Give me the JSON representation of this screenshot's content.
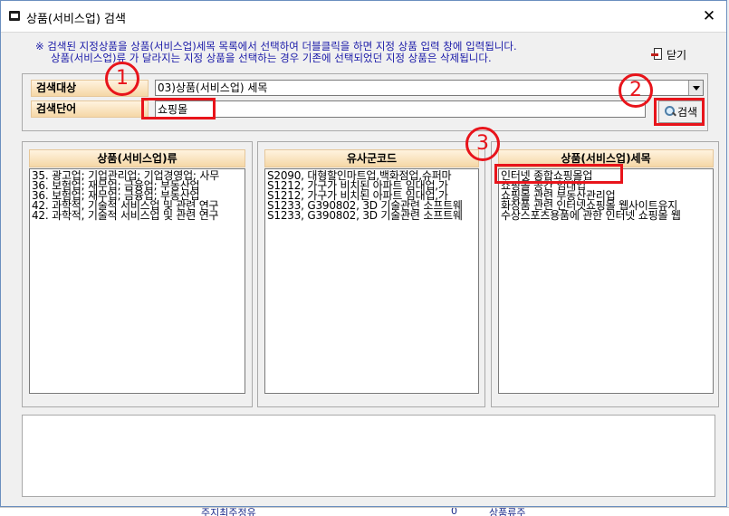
{
  "window": {
    "title": "상품(서비스업) 검색",
    "close_glyph": "✕"
  },
  "notice": {
    "line1": "※ 검색된 지정상품을 상품(서비스업)세목 목록에서 선택하여 더블클릭을 하면 지정 상품 입력 창에 입력됩니다.",
    "line2": "상품(서비스업)류 가 달라지는 지정 상품을 선택하는 경우 기존에 선택되었던 지정 상품은 삭제됩니다."
  },
  "toolbar": {
    "close_label": "닫기",
    "close_icon": "door-exit-icon"
  },
  "search": {
    "target_label": "검색대상",
    "target_value": "03)상품(서비스업) 세목",
    "keyword_label": "검색단어",
    "keyword_value": "쇼핑몰",
    "search_button_label": "검색",
    "search_icon": "magnifier-icon"
  },
  "panels": {
    "class": {
      "header": "상품(서비스업)류",
      "items": [
        "35. 광고업; 기업관리업; 기업경영업; 사무",
        "36. 보험업; 재무업; 금융업; 부동산업",
        "36. 보험업; 재무업; 금융업; 부동산업",
        "42. 과학적, 기술적 서비스업 및 관련 연구",
        "42. 과학적, 기술적 서비스업 및 관련 연구"
      ]
    },
    "similar": {
      "header": "유사군코드",
      "items": [
        "S2090, 대형할인마트업,백화점업,슈퍼마",
        "S1212, 가구가 비치된 아파트 임대업,가",
        "S1212, 가구가 비치된 아파트 임대업,가",
        "S1233, G390802, 3D 기술관련 소프트웨",
        "S1233, G390802, 3D 기술관련 소프트웨"
      ]
    },
    "detail": {
      "header": "상품(서비스업)세목",
      "items": [
        "인터넷 종합쇼핑몰업",
        "쇼핑몰 공간 임대업",
        "쇼핑몰 관련 부동산관리업",
        "화장품 관련 인터넷쇼핑몰 웹사이트유지",
        "수상스포츠용품에 관한 인터넷 쇼핑몰 웹"
      ]
    }
  },
  "background_window": {
    "text1": "주지최주정유",
    "text2": "0",
    "text3": "상품류주"
  },
  "annotations": {
    "step1": "1",
    "step2": "2",
    "step3": "3",
    "color": "#e8141b"
  },
  "colors": {
    "header_bg": "#f5d7a6",
    "notice_text": "#1a1aa8"
  }
}
